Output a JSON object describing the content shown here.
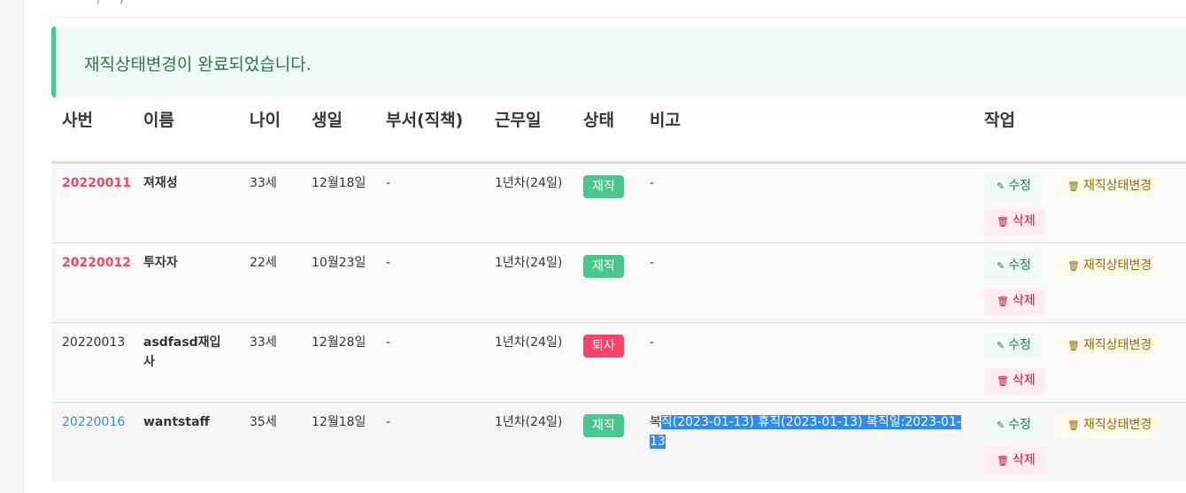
{
  "notification": {
    "message": "재직상태변경이 완료되었습니다."
  },
  "table": {
    "headers": [
      "사번",
      "이름",
      "나이",
      "생일",
      "부서(직책)",
      "근무일",
      "상태",
      "비고",
      "작업"
    ],
    "rows": [
      {
        "id": "20220011",
        "name": "져재성",
        "age": "33세",
        "birthday": "12월18일",
        "dept": "-",
        "workdays": "1년차(24일)",
        "status": "재직",
        "memo_plain": "-",
        "memo_selected": ""
      },
      {
        "id": "20220012",
        "name": "투자자",
        "age": "22세",
        "birthday": "10월23일",
        "dept": "-",
        "workdays": "1년차(24일)",
        "status": "재직",
        "memo_plain": "-",
        "memo_selected": ""
      },
      {
        "id": "20220013",
        "name": "asdfasd재입사",
        "age": "33세",
        "birthday": "12월28일",
        "dept": "-",
        "workdays": "1년차(24일)",
        "status": "퇴사",
        "memo_plain": "-",
        "memo_selected": ""
      },
      {
        "id": "20220016",
        "name": "wantstaff",
        "age": "35세",
        "birthday": "12월18일",
        "dept": "-",
        "workdays": "1년차(24일)",
        "status": "재직",
        "memo_plain": "복",
        "memo_selected": "직(2023-01-13) 휴직(2023-01-13) 복직일:2023-01-13"
      }
    ]
  },
  "actions": {
    "edit_label": "수정",
    "status_change_label": "재직상태변경",
    "delete_label": "삭제"
  },
  "colors": {
    "danger": "#f14668",
    "success": "#48c78e",
    "link": "#3e8ed0",
    "selection": "#2e8cf0"
  },
  "icons": {
    "edit": "edit-icon",
    "status": "trash-icon",
    "delete": "trash-icon"
  }
}
